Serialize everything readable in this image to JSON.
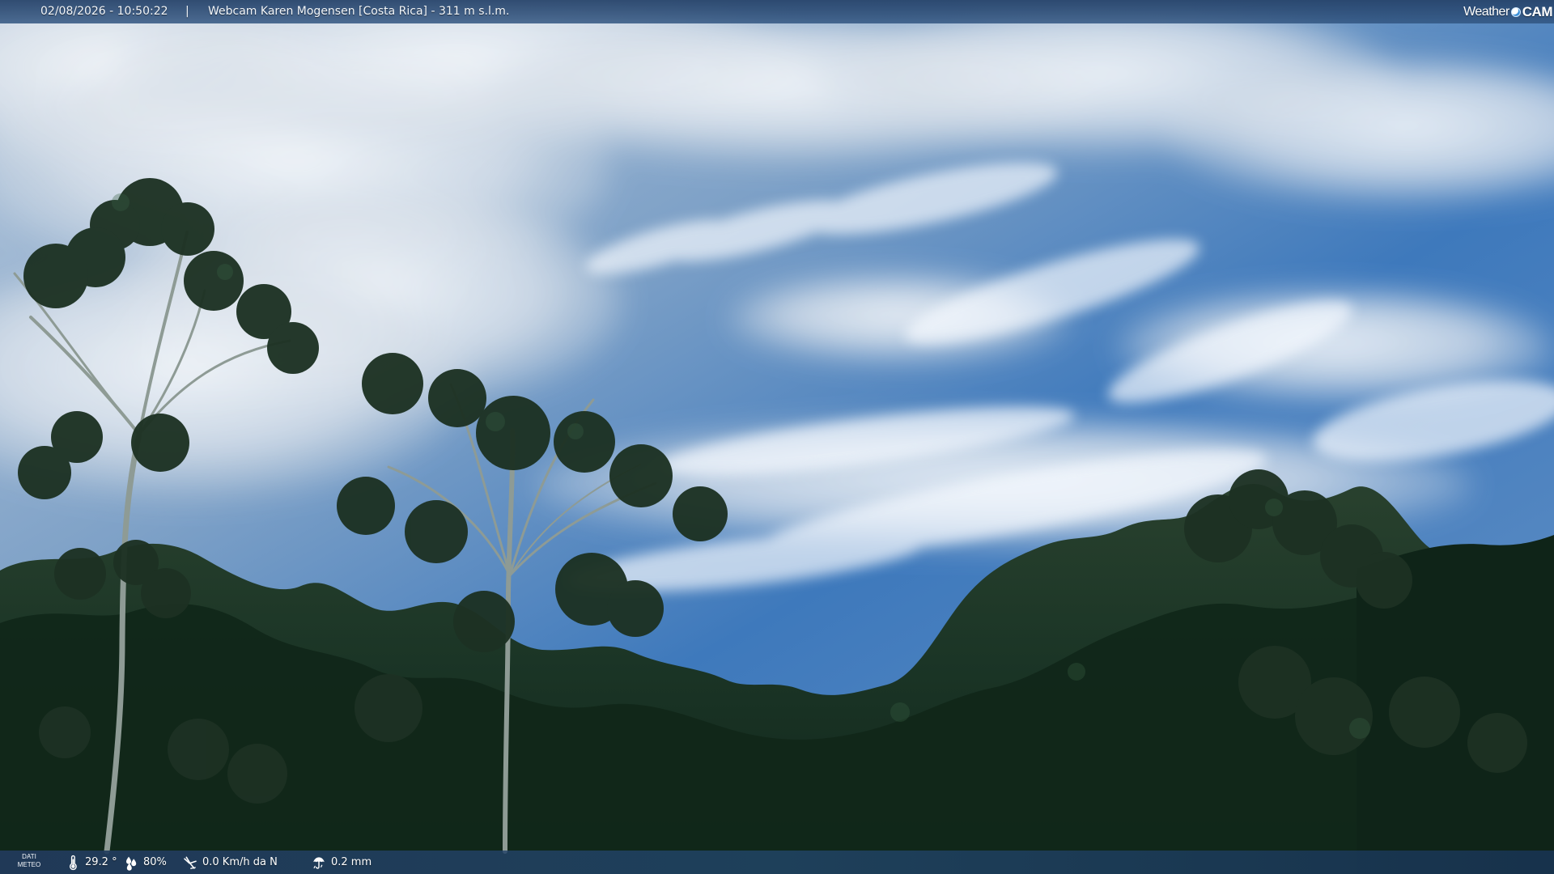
{
  "overlay": {
    "datetime": "02/08/2026 - 10:50:22",
    "separator": "|",
    "title": "Webcam Karen Mogensen [Costa Rica]  - 311 m s.l.m."
  },
  "brand": {
    "weather": "Weather",
    "cam": "CAM"
  },
  "weather": {
    "label_top": "DATI",
    "label_bottom": "METEO",
    "temperature": "29.2 °",
    "humidity": "80%",
    "wind": "0.0 Km/h da N",
    "rain": "0.2 mm"
  },
  "icons": {
    "temperature": "thermometer-icon",
    "humidity": "drops-icon",
    "wind": "wind-icon",
    "rain": "umbrella-icon",
    "brand": "globe-dot-icon"
  },
  "colors": {
    "sky": "#3f78b9",
    "cloud": "#f1f3f4",
    "forest": "#142b1f",
    "overlay": "#24466f",
    "text": "#ffffff"
  }
}
